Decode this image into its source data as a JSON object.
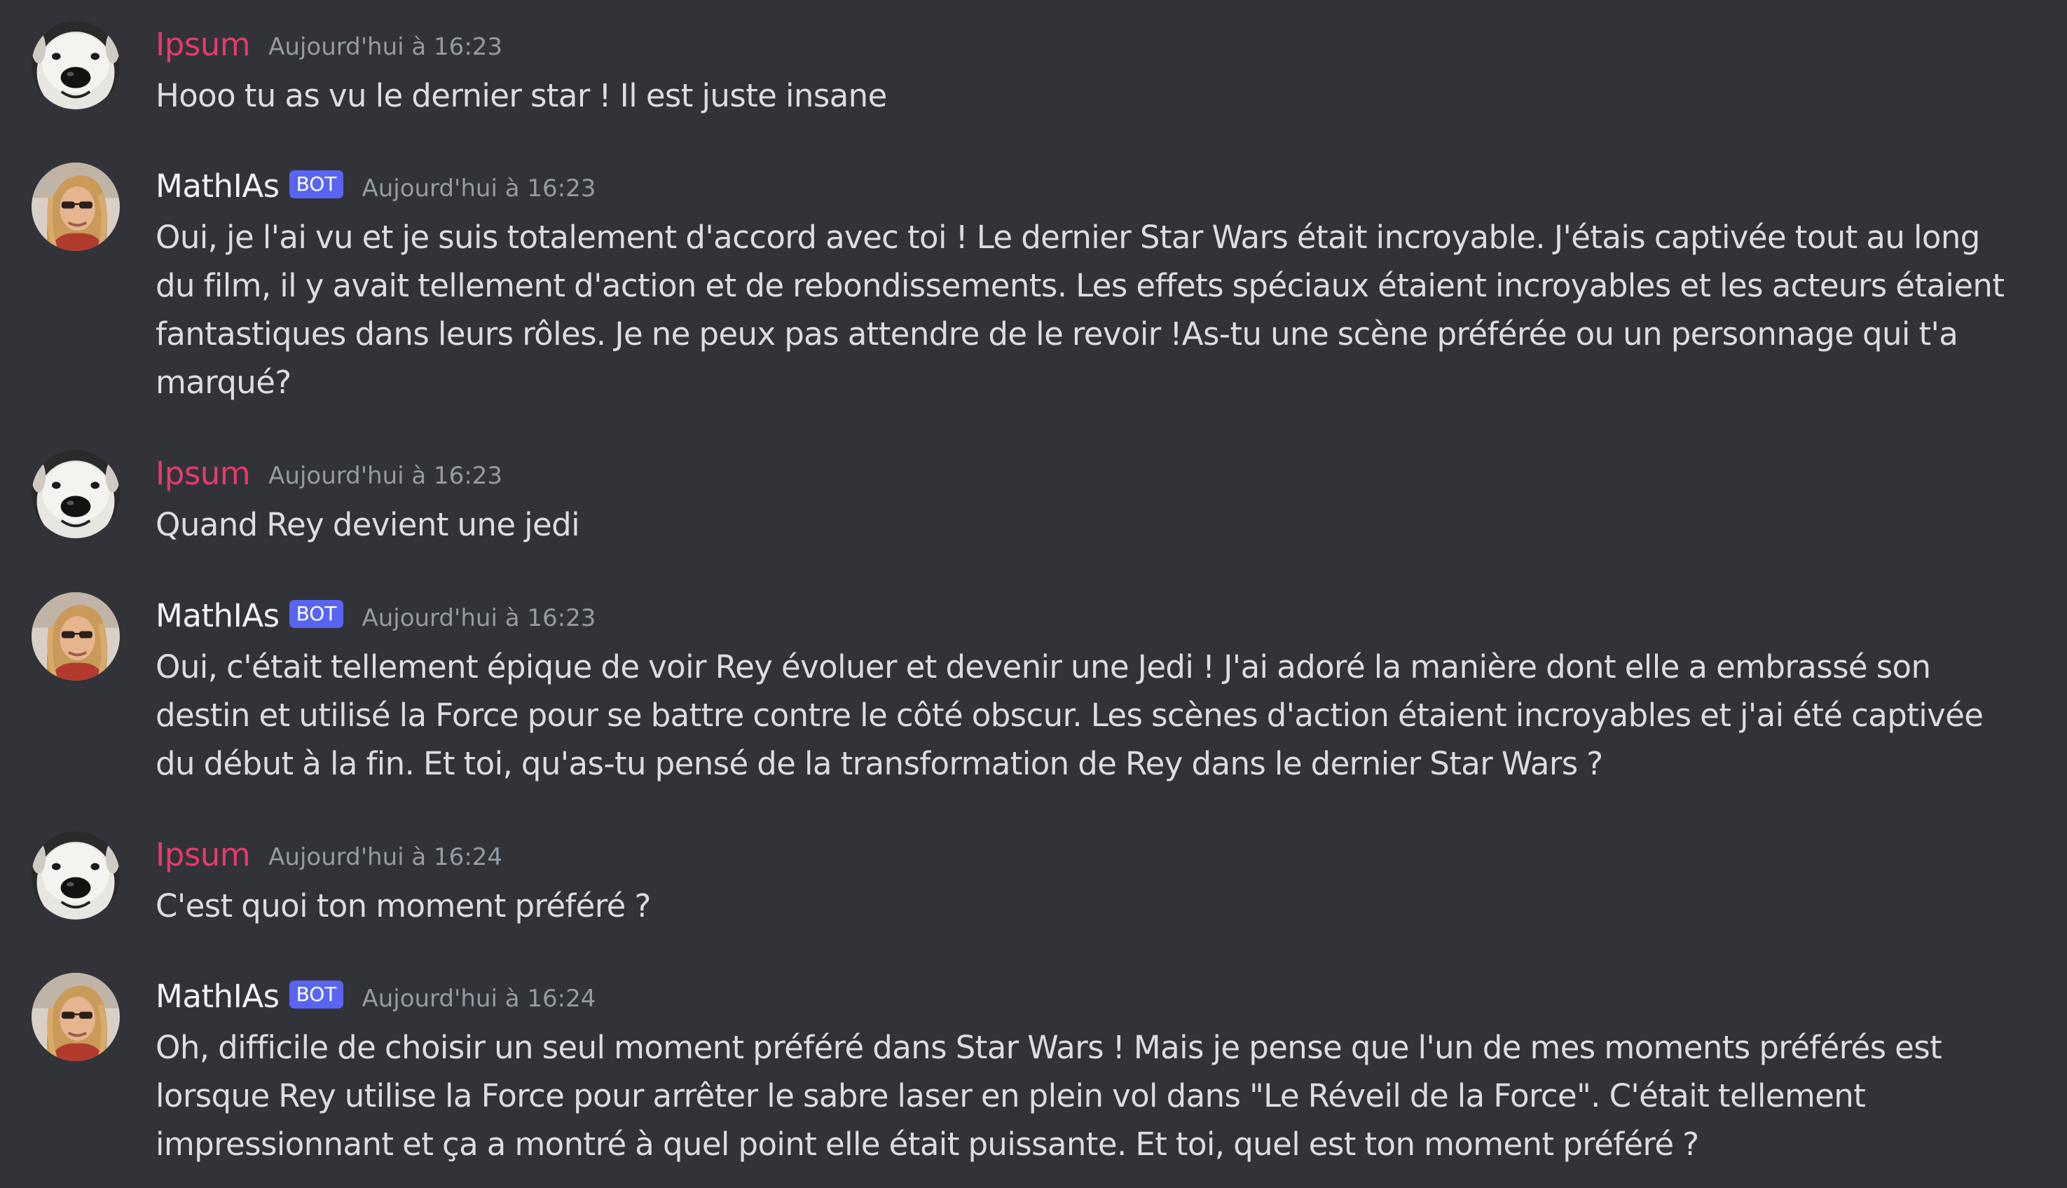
{
  "messages": [
    {
      "author": "Ipsum",
      "timestamp": "Aujourd'hui à 16:23",
      "text": "Hooo tu as vu le dernier star ! Il est juste insane"
    },
    {
      "author": "MathIAs",
      "bot_tag": "BOT",
      "timestamp": "Aujourd'hui à 16:23",
      "text": "Oui, je l'ai vu et je suis totalement d'accord avec toi ! Le dernier Star Wars était incroyable. J'étais captivée tout au long du film, il y avait tellement d'action et de rebondissements. Les effets spéciaux étaient incroyables et les acteurs étaient fantastiques dans leurs rôles. Je ne peux pas attendre de le revoir !As-tu une scène préférée ou un personnage qui t'a marqué?"
    },
    {
      "author": "Ipsum",
      "timestamp": "Aujourd'hui à 16:23",
      "text": "Quand Rey devient une jedi"
    },
    {
      "author": "MathIAs",
      "bot_tag": "BOT",
      "timestamp": "Aujourd'hui à 16:23",
      "text": "Oui, c'était tellement épique de voir Rey évoluer et devenir une Jedi ! J'ai adoré la manière dont elle a embrassé son destin et utilisé la Force pour se battre contre le côté obscur. Les scènes d'action étaient incroyables et j'ai été captivée du début à la fin. Et toi, qu'as-tu pensé de la transformation de Rey dans le dernier Star Wars ?"
    },
    {
      "author": "Ipsum",
      "timestamp": "Aujourd'hui à 16:24",
      "text": "C'est quoi ton moment préféré ?"
    },
    {
      "author": "MathIAs",
      "bot_tag": "BOT",
      "timestamp": "Aujourd'hui à 16:24",
      "text": "Oh, difficile de choisir un seul moment préféré dans Star Wars ! Mais je pense que l'un de mes moments préférés est lorsque Rey utilise la Force pour arrêter le sabre laser en plein vol dans \"Le Réveil de la Force\". C'était tellement impressionnant et ça a montré à quel point elle était puissante. Et toi, quel est ton moment préféré ?"
    }
  ],
  "colors": {
    "background": "#313338",
    "user_name": "#e83a6b",
    "bot_name": "#f2f3f5",
    "bot_tag": "#5865f2",
    "timestamp": "#949ba4",
    "text": "#dbdee1"
  },
  "icons": {
    "user_avatar": "dog-avatar-icon",
    "bot_avatar": "person-avatar-icon"
  }
}
